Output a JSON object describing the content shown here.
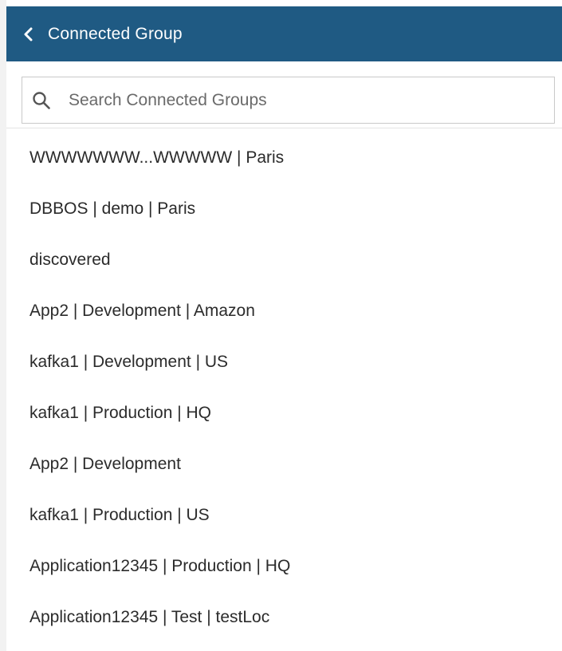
{
  "header": {
    "title": "Connected Group",
    "back_icon": "chevron-left-icon",
    "background_color": "#1f5a83"
  },
  "search": {
    "placeholder": "Search Connected Groups",
    "value": "",
    "icon": "search-icon"
  },
  "groups": [
    "WWWWWWW...WWWWW | Paris",
    "DBBOS | demo | Paris",
    "discovered",
    "App2 | Development | Amazon",
    "kafka1 | Development | US",
    "kafka1 | Production | HQ",
    "App2 | Development",
    "kafka1 | Production | US",
    "Application12345 | Production | HQ",
    "Application12345 | Test | testLoc"
  ]
}
